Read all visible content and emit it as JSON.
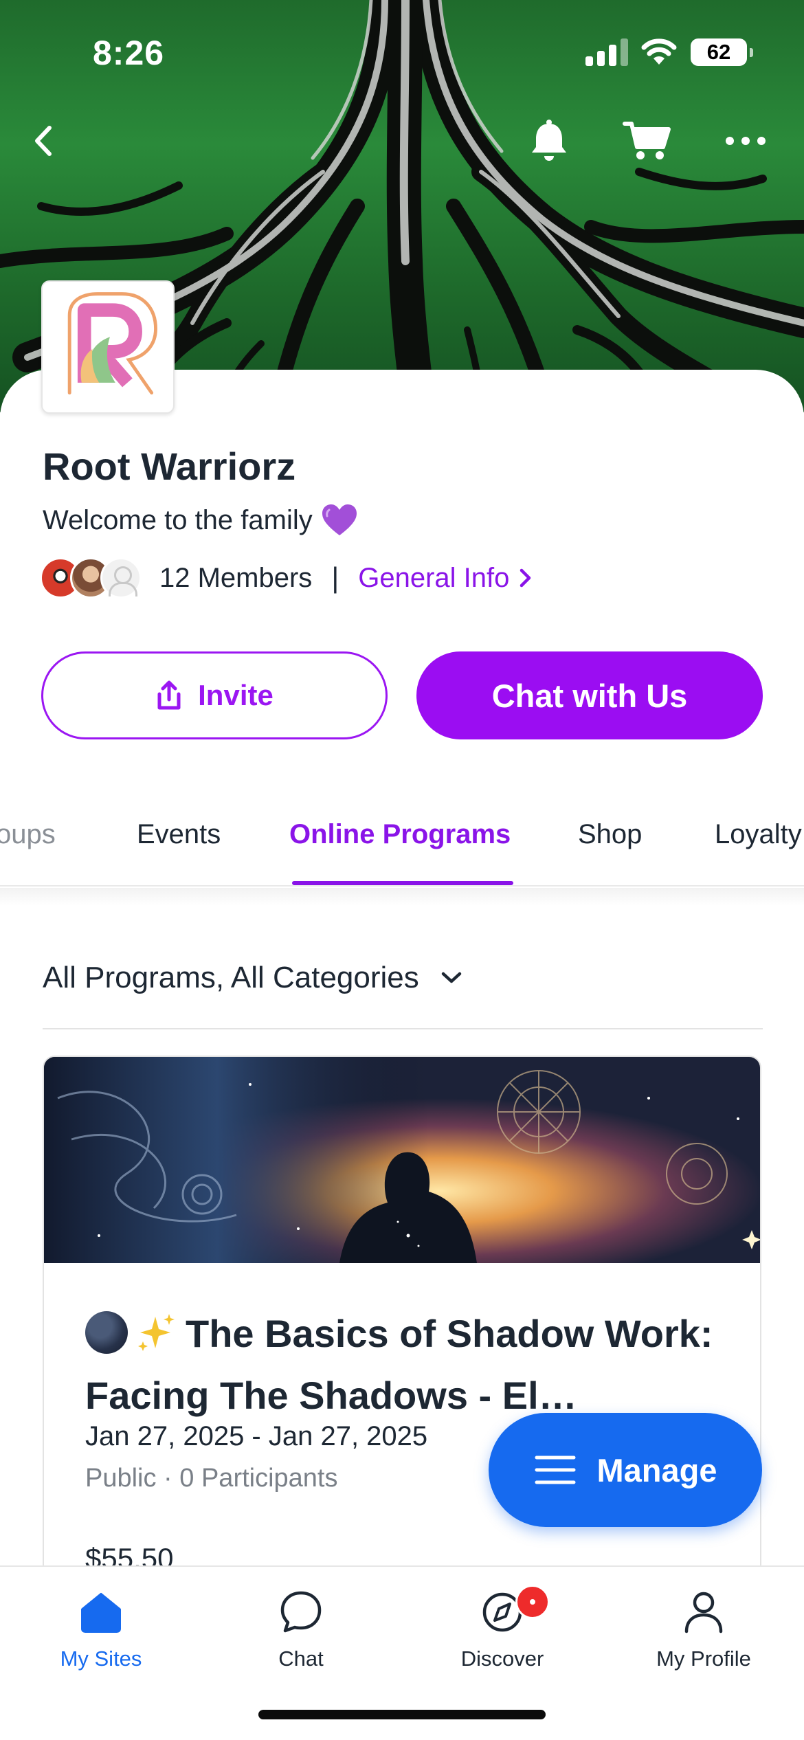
{
  "status_bar": {
    "time": "8:26",
    "battery": "62"
  },
  "site": {
    "name": "Root Warriorz",
    "tagline": "Welcome to the family",
    "members": "12 Members",
    "separator": "|",
    "general_info": "General Info"
  },
  "actions": {
    "invite": "Invite",
    "chat": "Chat with Us"
  },
  "tabs": [
    "oups",
    "Events",
    "Online Programs",
    "Shop",
    "Loyalty"
  ],
  "filter": {
    "label": "All Programs, All Categories"
  },
  "program": {
    "title": "The Basics of Shadow Work: Facing The Shadows - El…",
    "dates": "Jan 27, 2025 - Jan 27, 2025",
    "meta": "Public · 0 Participants",
    "price": "$55.50"
  },
  "fab": {
    "label": "Manage"
  },
  "bottom_nav": [
    {
      "label": "My Sites",
      "icon": "home-icon",
      "active": true
    },
    {
      "label": "Chat",
      "icon": "chat-icon",
      "active": false
    },
    {
      "label": "Discover",
      "icon": "compass-icon",
      "active": false
    },
    {
      "label": "My Profile",
      "icon": "person-icon",
      "active": false
    }
  ],
  "colors": {
    "accent_purple": "#9b16f2",
    "primary_blue": "#166aef",
    "badge_red": "#ee2b2b",
    "text_dark": "#1d2733"
  }
}
